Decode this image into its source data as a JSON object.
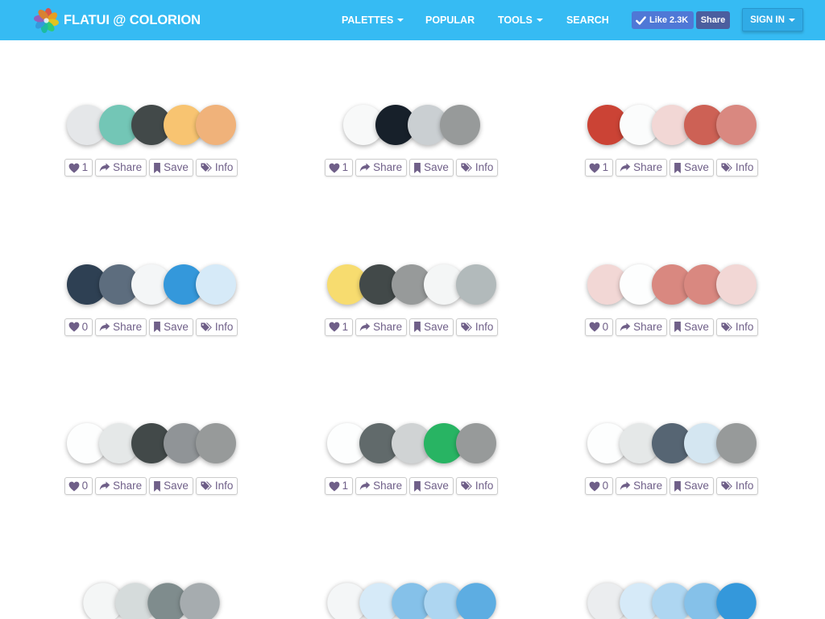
{
  "header": {
    "brand": "FLATUI @ COLORION",
    "logo_icon": "pinwheel-logo-icon",
    "nav": [
      {
        "label": "PALETTES",
        "dropdown": true
      },
      {
        "label": "POPULAR",
        "dropdown": false
      },
      {
        "label": "TOOLS",
        "dropdown": true
      },
      {
        "label": "SEARCH",
        "dropdown": false
      }
    ],
    "facebook": {
      "like_icon": "check-icon",
      "like_label": "Like",
      "like_count": "2.3K",
      "share_label": "Share"
    },
    "sign_in": {
      "label": "SIGN IN",
      "dropdown": true
    }
  },
  "theme": {
    "header_bg": "#36bbf3",
    "fb_like_bg": "#4f78d6",
    "fb_share_bg": "#4b5e9f",
    "sign_in_bg": "#30abe6",
    "action_text": "#6f5f88",
    "action_border": "#cccccc",
    "page_bg": "#ffffff"
  },
  "action_icons": {
    "like": "heart-icon",
    "share": "share-arrow-icon",
    "save": "bookmark-icon",
    "info": "tags-icon"
  },
  "action_labels": {
    "share": "Share",
    "save": "Save",
    "info": "Info"
  },
  "palettes": [
    {
      "colors": [
        "#E5E7E9",
        "#73C6B6",
        "#424949",
        "#F8C471",
        "#F0B27A"
      ],
      "likes": 1
    },
    {
      "colors": [
        "#F8F9F9",
        "#17202A",
        "#CACFD2",
        "#979A9A"
      ],
      "likes": 1
    },
    {
      "colors": [
        "#CB4335",
        "#FBFCFC",
        "#F2D7D5",
        "#CD6155",
        "#D98880"
      ],
      "likes": 1
    },
    {
      "colors": [
        "#2E4053",
        "#5D6D7E",
        "#F4F6F7",
        "#3498DB",
        "#D6EAF8"
      ],
      "likes": 0
    },
    {
      "colors": [
        "#F7DC6F",
        "#424949",
        "#979A9A",
        "#F4F6F6",
        "#B2BABB"
      ],
      "likes": 1
    },
    {
      "colors": [
        "#F2D7D5",
        "#FDFEFE",
        "#D98880",
        "#D98880",
        "#F2D7D5"
      ],
      "likes": 0
    },
    {
      "colors": [
        "#FDFEFE",
        "#E5E8E8",
        "#424949",
        "#909497",
        "#979A9A"
      ],
      "likes": 0
    },
    {
      "colors": [
        "#FDFEFE",
        "#616A6B",
        "#D0D3D4",
        "#28B463",
        "#979A9A"
      ],
      "likes": 1
    },
    {
      "colors": [
        "#FDFEFE",
        "#E5E8E8",
        "#566573",
        "#D4E6F1",
        "#979A9A"
      ],
      "likes": 0
    },
    {
      "colors": [
        "#F4F6F6",
        "#D5DBDB",
        "#7F8C8D",
        "#A6ACAF"
      ]
    },
    {
      "colors": [
        "#F4F6F7",
        "#D6EAF8",
        "#85C1E9",
        "#AED6F1",
        "#5DADE2"
      ]
    },
    {
      "colors": [
        "#EBEDEF",
        "#D6EAF8",
        "#AED6F1",
        "#85C1E9",
        "#3498DB"
      ]
    }
  ]
}
